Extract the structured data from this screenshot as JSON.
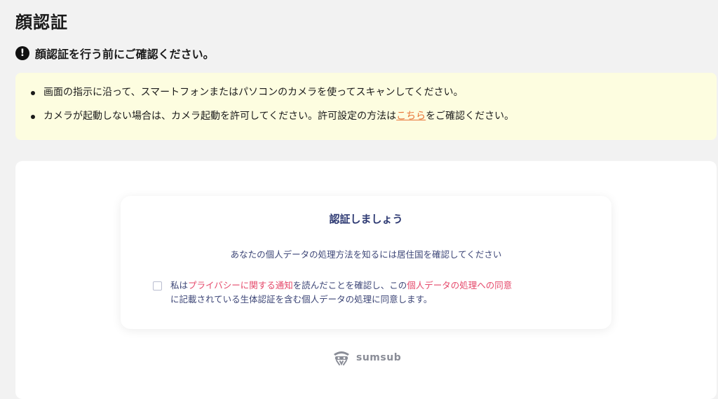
{
  "page": {
    "title": "顔認証"
  },
  "notice": {
    "heading": "顔認証を行う前にご確認ください。",
    "icon": "exclamation-circle-icon",
    "item1": "画面の指示に沿って、スマートフォンまたはパソコンのカメラを使ってスキャンしてください。",
    "item2_before": "カメラが起動しない場合は、カメラ起動を許可してください。許可設定の方法は",
    "item2_link": "こちら",
    "item2_after": "をご確認ください。",
    "link_color": "#e8763a",
    "box_color": "#fdfde0"
  },
  "card": {
    "title": "認証しましょう",
    "subtitle": "あなたの個人データの処理方法を知るには居住国を確認してください",
    "consent": {
      "checked": false,
      "part1": "私は",
      "link1": "プライバシーに関する通知",
      "part2": "を読んだことを確認し、この",
      "link2": "個人データの処理への同意",
      "part3": "に記載されている生体認証を含む個人データの処理に同意します。",
      "link_color": "#e5486a"
    },
    "text_color": "#2e3a73"
  },
  "brand": {
    "name": "sumsub",
    "icon": "sumsub-logo-icon"
  }
}
